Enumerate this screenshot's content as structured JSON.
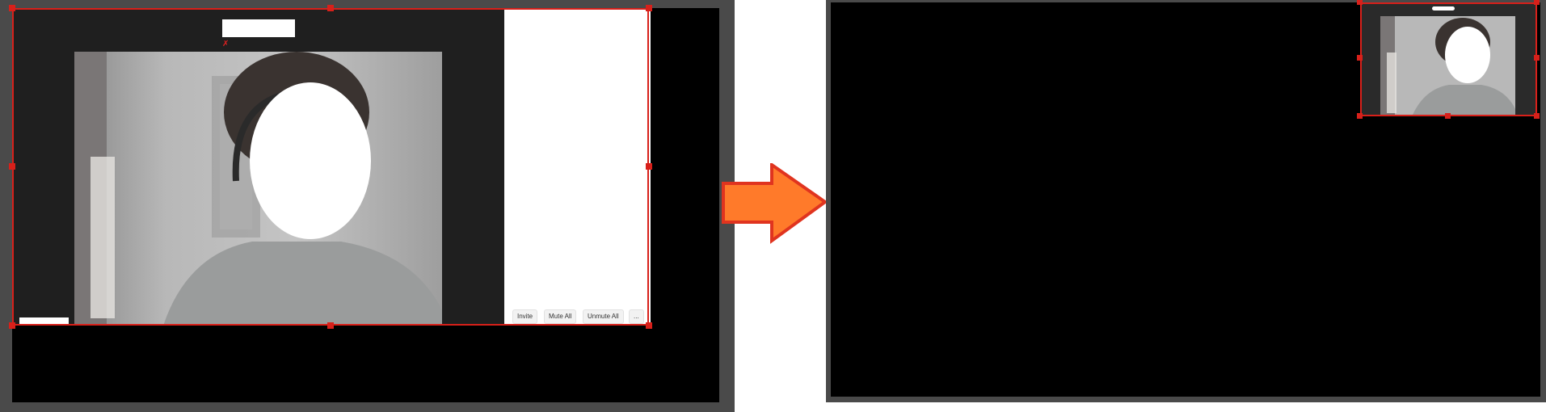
{
  "left": {
    "participants_buttons": {
      "invite": "Invite",
      "mute_all": "Mute All",
      "unmute_all": "Unmute All",
      "more": "..."
    },
    "mic_icon": "muted-mic-icon"
  },
  "arrow": {
    "icon": "right-arrow-icon",
    "fill": "#ff7a2a",
    "stroke": "#e0341f"
  },
  "colors": {
    "selection": "#d8201a",
    "frame": "#4a4a4a",
    "canvas": "#000000",
    "window": "#1f1f1f"
  }
}
